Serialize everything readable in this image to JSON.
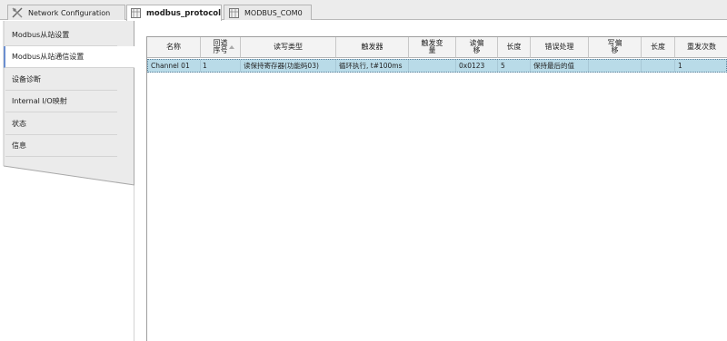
{
  "tabs": [
    {
      "label": "Network Configuration",
      "icon": "network-config-icon",
      "active": false
    },
    {
      "label": "modbus_protocol",
      "icon": "device-icon",
      "active": true,
      "close": "✕"
    },
    {
      "label": "MODBUS_COM0",
      "icon": "device-icon",
      "active": false
    }
  ],
  "sidebar": {
    "items": [
      {
        "label": "Modbus从站设置",
        "active": false
      },
      {
        "label": "Modbus从站通信设置",
        "active": true
      },
      {
        "label": "设备诊断",
        "active": false
      },
      {
        "label": "Internal I/O映射",
        "active": false
      },
      {
        "label": "状态",
        "active": false
      },
      {
        "label": "信息",
        "active": false
      }
    ]
  },
  "table": {
    "columns": [
      "名称",
      "回道\n序号",
      "读写类型",
      "触发器",
      "触发变\n量",
      "读偏\n移",
      "长度",
      "错误处理",
      "写偏\n移",
      "长度",
      "重发次数"
    ],
    "rows": [
      [
        "Channel 01",
        "1",
        "读保持寄存器(功能码03)",
        "循环执行, t#100ms",
        "",
        "0x0123",
        "5",
        "保持最后的值",
        "",
        "",
        "1"
      ]
    ]
  },
  "colors": {
    "selected_row": "#b9dbe8",
    "active_accent": "#6b8fd0"
  }
}
